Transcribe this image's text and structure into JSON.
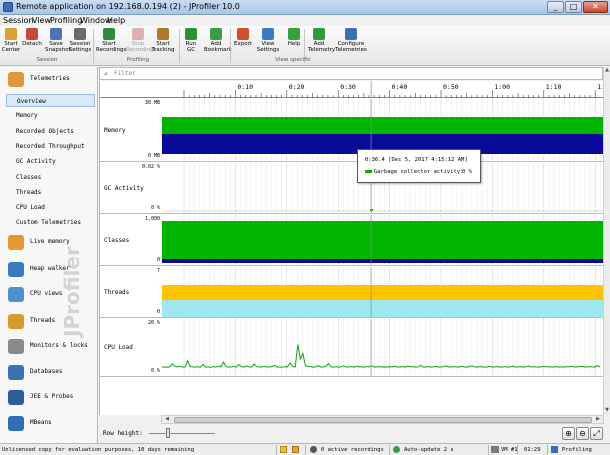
{
  "window": {
    "title": "Remote application on 192.168.0.194 (2) - JProfiler 10.0",
    "min": "_",
    "max": "□",
    "close": "✕"
  },
  "menu": [
    "Session",
    "View",
    "Profiling",
    "Window",
    "Help"
  ],
  "toolbar": {
    "buttons": [
      {
        "label": "Start\nCenter",
        "icon": "start-center-icon",
        "color": "#d9a13a"
      },
      {
        "label": "Detach",
        "icon": "detach-icon",
        "color": "#c44b3a"
      },
      {
        "label": "Save\nSnapshot",
        "icon": "save-snapshot-icon",
        "color": "#4a76b8"
      },
      {
        "label": "Session\nSettings",
        "icon": "session-settings-icon",
        "color": "#6a6a6a"
      },
      {
        "label": "Start\nRecordings",
        "icon": "start-recordings-icon",
        "color": "#2d8a3e"
      },
      {
        "label": "Stop\nRecordings",
        "icon": "stop-recordings-icon",
        "color": "#aa3333"
      },
      {
        "label": "Start\nTracking",
        "icon": "start-tracking-icon",
        "color": "#b07a2a"
      },
      {
        "label": "Run GC",
        "icon": "run-gc-icon",
        "color": "#2f8f3c"
      },
      {
        "label": "Add\nBookmark",
        "icon": "add-bookmark-icon",
        "color": "#3a9c45"
      },
      {
        "label": "Export",
        "icon": "export-icon",
        "color": "#d0502a"
      },
      {
        "label": "View\nSettings",
        "icon": "view-settings-icon",
        "color": "#3b7bbf"
      },
      {
        "label": "Help",
        "icon": "help-icon",
        "color": "#36a03f"
      },
      {
        "label": "Add\nTelemetry",
        "icon": "add-telemetry-icon",
        "color": "#2f9a3a"
      },
      {
        "label": "Configure\nTelemetries",
        "icon": "configure-telemetries-icon",
        "color": "#3a70b0"
      }
    ],
    "groups": [
      "Session",
      "Profiling",
      "View specific"
    ]
  },
  "sidebar": {
    "categories": [
      {
        "label": "Telemetries",
        "icon": "telemetries-icon",
        "color": "#e0963a"
      },
      {
        "label": "Live memory",
        "icon": "live-memory-icon",
        "color": "#e39b2e"
      },
      {
        "label": "Heap walker",
        "icon": "heap-walker-icon",
        "color": "#3b7bbf"
      },
      {
        "label": "CPU views",
        "icon": "cpu-views-icon",
        "color": "#4f8fcf"
      },
      {
        "label": "Threads",
        "icon": "threads-icon",
        "color": "#d69a2e"
      },
      {
        "label": "Monitors & locks",
        "icon": "monitors-locks-icon",
        "color": "#8a8a8a"
      },
      {
        "label": "Databases",
        "icon": "databases-icon",
        "color": "#3d6fb2"
      },
      {
        "label": "JEE & Probes",
        "icon": "jee-probes-icon",
        "color": "#2e5e9a"
      },
      {
        "label": "MBeans",
        "icon": "mbeans-icon",
        "color": "#2f6fb4"
      }
    ],
    "telemetry_items": [
      "Overview",
      "Memory",
      "Recorded Objects",
      "Recorded Throughput",
      "GC Activity",
      "Classes",
      "Threads",
      "CPU Load",
      "Custom Telemetries"
    ],
    "selected": "Overview",
    "watermark": "JProfiler"
  },
  "filter": {
    "placeholder": "Filter",
    "icon": "search-icon"
  },
  "timeline": {
    "ticks": [
      "0:10",
      "0:20",
      "0:30",
      "0:40",
      "0:50",
      "1:00",
      "1:10",
      "1:20"
    ],
    "cursor_time": "0:36.4"
  },
  "lanes": [
    {
      "label": "Memory",
      "top_axis": "30 MB",
      "bottom_axis": "0 MB"
    },
    {
      "label": "GC Activity",
      "top_axis": "0.02 %",
      "bottom_axis": "0 %"
    },
    {
      "label": "Classes",
      "top_axis": "1,000",
      "bottom_axis": "0"
    },
    {
      "label": "Threads",
      "top_axis": "7",
      "bottom_axis": "0"
    },
    {
      "label": "CPU Load",
      "top_axis": "20 %",
      "bottom_axis": "0 %"
    }
  ],
  "cpu_load_series": [
    0.4,
    0.5,
    0.3,
    0.5,
    1.8,
    0.8,
    0.5,
    0.7,
    0.4,
    0.5,
    3.2,
    0.6,
    0.5,
    0.4,
    0.6,
    0.3,
    1.6,
    0.4,
    0.5,
    0.3,
    0.6,
    0.4,
    0.8,
    0.5,
    2.6,
    0.6,
    0.4,
    0.5,
    0.7,
    0.4,
    1.5,
    0.6,
    0.4,
    0.9,
    0.5,
    0.4,
    1.8,
    0.6,
    0.4,
    0.5,
    0.7,
    0.4,
    0.5,
    0.6,
    1.2,
    0.4,
    0.5,
    0.3,
    0.6,
    0.5,
    2.2,
    0.7,
    0.5,
    10.5,
    4.0,
    6.5,
    1.0,
    0.7,
    0.6,
    0.4,
    0.5,
    1.1,
    0.4,
    0.5,
    0.7,
    2.0,
    0.5,
    0.4,
    0.6,
    0.4,
    0.5,
    1.0,
    0.4,
    0.5,
    0.6,
    0.4,
    0.7,
    0.5,
    0.5,
    0.4,
    0.6,
    0.5,
    1.0,
    0.4,
    0.5,
    0.6,
    0.4,
    0.5,
    0.4,
    0.6,
    0.5,
    0.7,
    0.4,
    0.5,
    0.6,
    0.4,
    0.8,
    0.5,
    0.6,
    0.4,
    0.5,
    1.2,
    0.4,
    0.5,
    0.6,
    0.4,
    0.5,
    0.7,
    0.4,
    0.5,
    0.6,
    0.9,
    0.4,
    0.5,
    0.6,
    0.5,
    0.4,
    0.7,
    0.5,
    0.4,
    0.6,
    1.0,
    0.5,
    0.4,
    0.6,
    0.5,
    0.4,
    0.5,
    0.7,
    0.4,
    0.5,
    0.6,
    0.4,
    0.5,
    0.6,
    0.4,
    0.5,
    0.8,
    0.4,
    0.5,
    0.6,
    0.4,
    0.5,
    1.0,
    0.4,
    0.6,
    0.5,
    0.4,
    0.5,
    0.7,
    0.5,
    0.6,
    0.4,
    0.5,
    0.6,
    0.4,
    0.5,
    0.4,
    0.6,
    0.5,
    0.8,
    0.4,
    0.5,
    0.6,
    0.7,
    0.4,
    0.5,
    0.6,
    0.5,
    0.4,
    1.1,
    0.5
  ],
  "tooltip": {
    "time": "0:36.4 [Dec 5, 2017 4:15:12 AM]",
    "series": "Garbage collector activity:",
    "value": "0 %"
  },
  "row_height": {
    "label": "Row height:"
  },
  "statusbar": {
    "license": "Unlicensed copy for evaluation purposes, 10 days remaining",
    "recordings": "0 active recordings",
    "autoupdate": "Auto-update 2 s",
    "vm": "VM #1",
    "time": "01:29",
    "mode": "Profiling"
  },
  "colors": {
    "green": "#00b400",
    "navy": "#0a0a9a",
    "yellow": "#ffc400",
    "cyan": "#9fe8f0",
    "cpu": "#12a012"
  }
}
